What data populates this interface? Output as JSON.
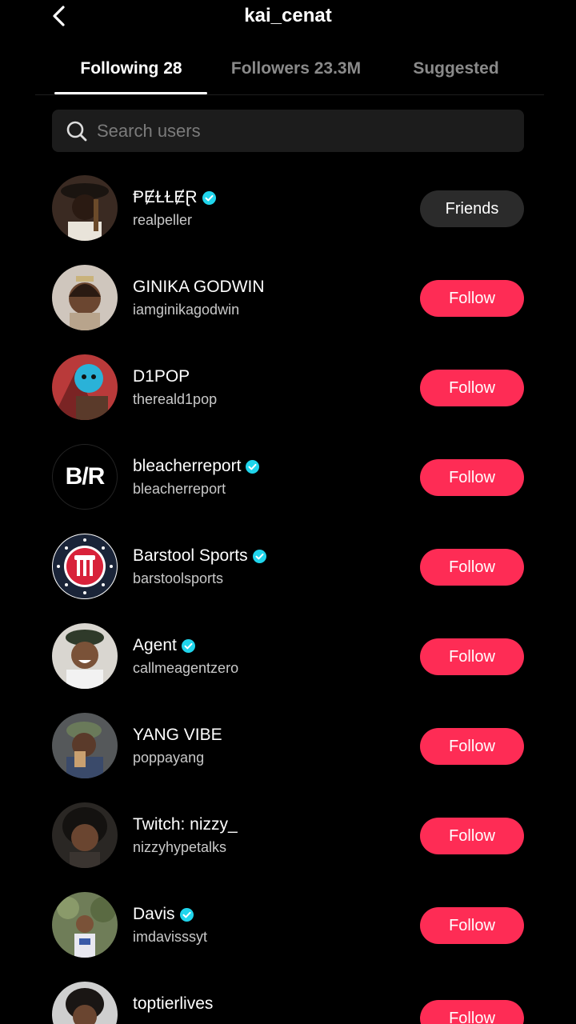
{
  "header": {
    "title": "kai_cenat",
    "back_icon": "chevron-left-icon"
  },
  "tabs": [
    {
      "label": "Following 28",
      "active": true
    },
    {
      "label": "Followers 23.3M",
      "active": false
    },
    {
      "label": "Suggested",
      "active": false
    }
  ],
  "search": {
    "placeholder": "Search users",
    "value": ""
  },
  "colors": {
    "follow": "#fe2c55",
    "friends": "#2b2b2b",
    "verified": "#20d5ec",
    "background": "#000000"
  },
  "users": [
    {
      "display_name": "ⱣɆⱢⱢɆⱤ",
      "username": "realpeller",
      "verified": true,
      "action": "Friends"
    },
    {
      "display_name": "GINIKA GODWIN",
      "username": "iamginikagodwin",
      "verified": false,
      "action": "Follow"
    },
    {
      "display_name": "D1POP",
      "username": "thereald1pop",
      "verified": false,
      "action": "Follow"
    },
    {
      "display_name": "bleacherreport",
      "username": "bleacherreport",
      "verified": true,
      "action": "Follow",
      "avatar_text": "B/R"
    },
    {
      "display_name": "Barstool Sports",
      "username": "barstoolsports",
      "verified": true,
      "action": "Follow"
    },
    {
      "display_name": "Agent",
      "username": "callmeagentzero",
      "verified": true,
      "action": "Follow"
    },
    {
      "display_name": "YANG VIBE",
      "username": "poppayang",
      "verified": false,
      "action": "Follow"
    },
    {
      "display_name": "Twitch: nizzy_",
      "username": "nizzyhypetalks",
      "verified": false,
      "action": "Follow"
    },
    {
      "display_name": "Davis",
      "username": "imdavisssyt",
      "verified": true,
      "action": "Follow"
    },
    {
      "display_name": "toptierlives",
      "username": "",
      "verified": false,
      "action": "Follow"
    }
  ]
}
